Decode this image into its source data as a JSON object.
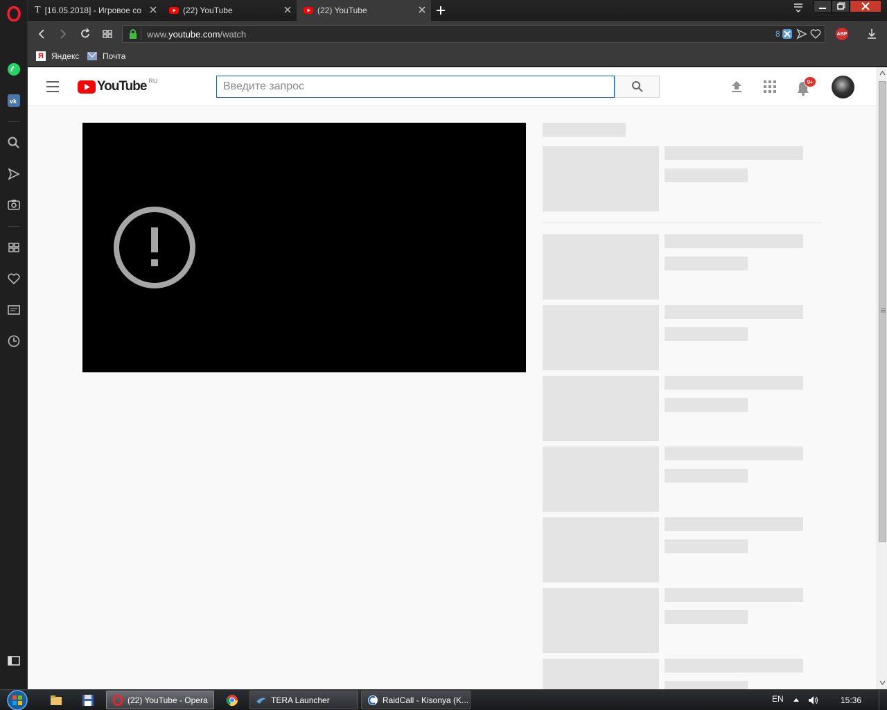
{
  "browser": {
    "tabs": [
      {
        "title": "[16.05.2018] - Игровое со",
        "icon": "t-icon"
      },
      {
        "title": "(22) YouTube",
        "icon": "youtube-icon"
      },
      {
        "title": "(22) YouTube",
        "icon": "youtube-icon",
        "active": true
      }
    ],
    "url_prefix": "www.",
    "url_domain": "youtube.com",
    "url_path": "/watch",
    "tracker_count": "8",
    "adblock_label": "ABP",
    "bookmarks": [
      {
        "label": "Яндекс",
        "icon": "yandex-icon"
      },
      {
        "label": "Почта",
        "icon": "mail-icon"
      }
    ]
  },
  "youtube": {
    "logo_text": "YouTube",
    "logo_region": "RU",
    "search_placeholder": "Введите запрос",
    "notification_badge": "9+"
  },
  "taskbar": {
    "items": [
      {
        "label": "(22) YouTube - Opera",
        "icon": "opera-icon",
        "active": true
      },
      {
        "label": "TERA Launcher",
        "icon": "tera-icon"
      },
      {
        "label": "RaidCall - Kisonya (K...",
        "icon": "raidcall-icon"
      }
    ],
    "language": "EN",
    "time": "15:36"
  },
  "colors": {
    "accent": "#cc0000",
    "search_border": "#1c62b9",
    "opera_red": "#ff1b2d"
  }
}
